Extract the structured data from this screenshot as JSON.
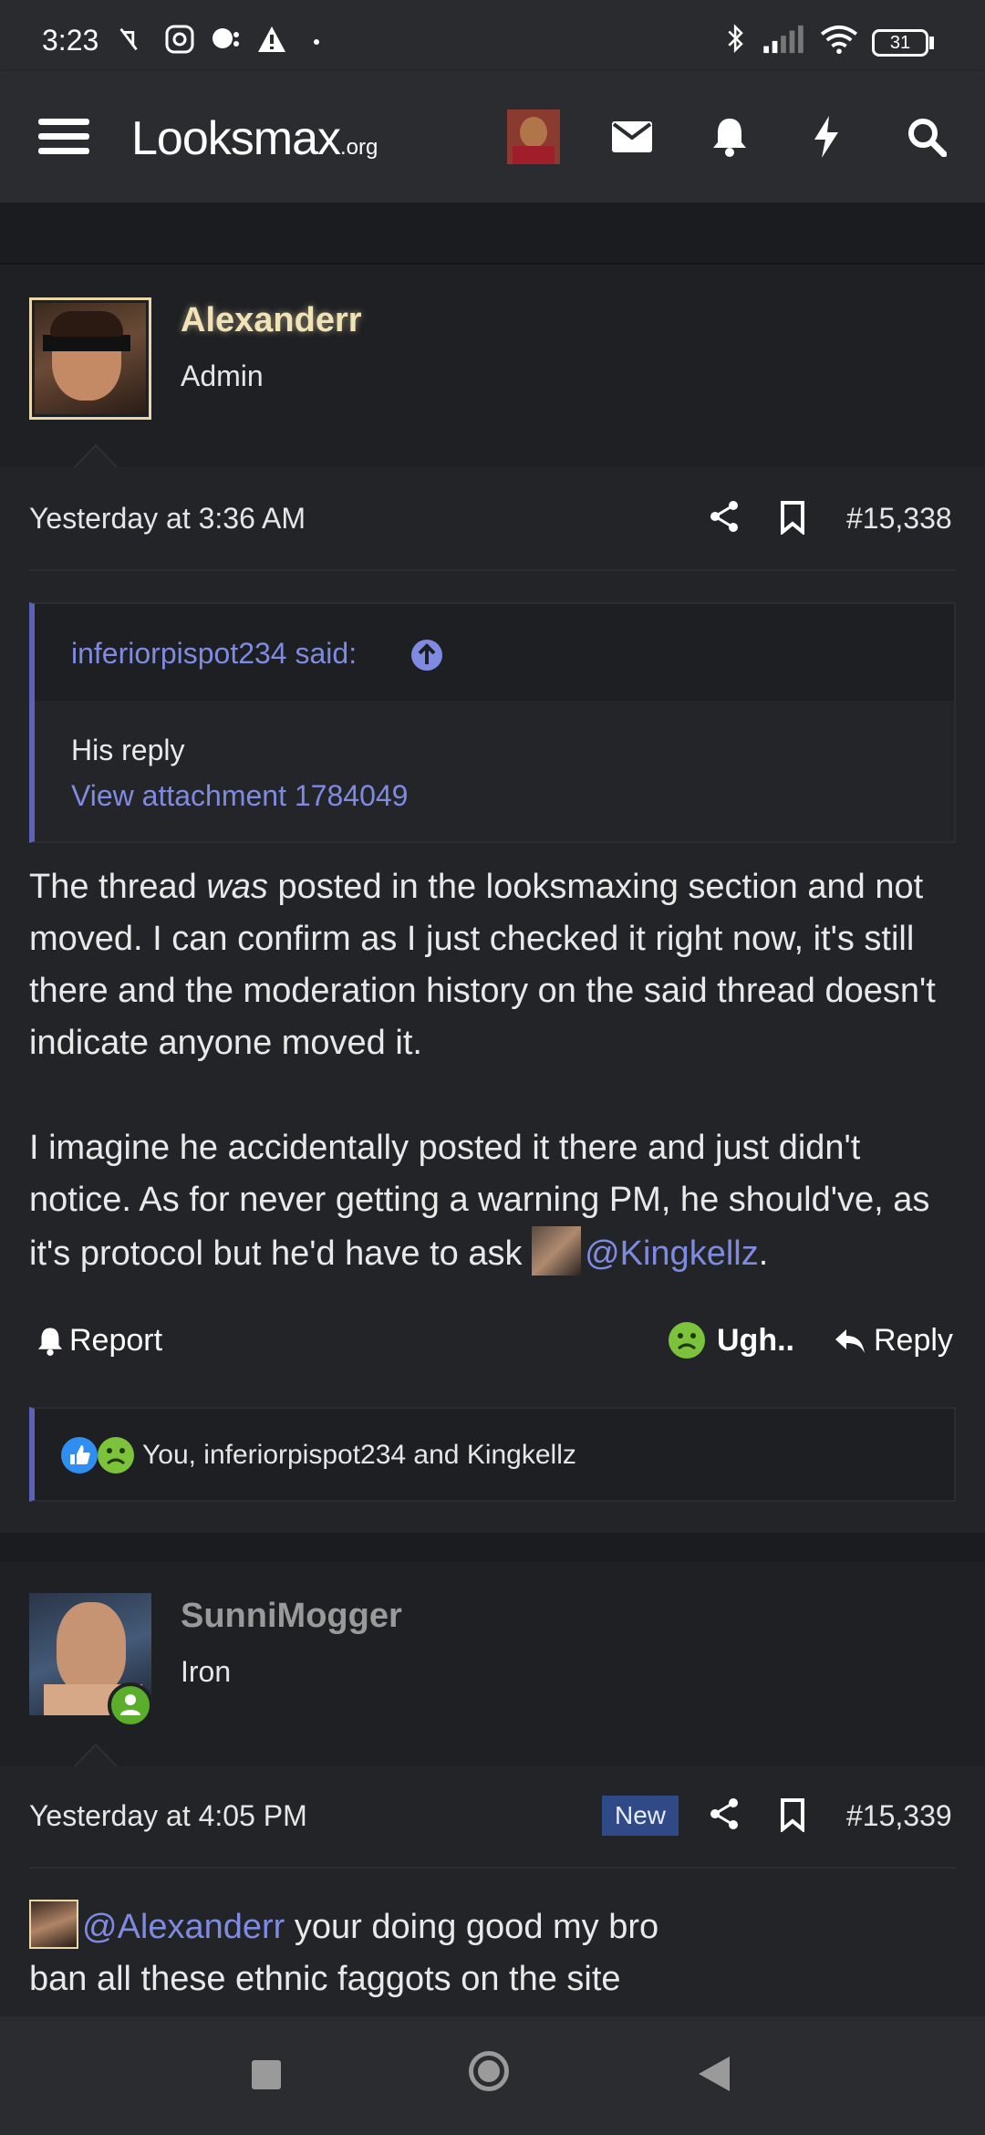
{
  "status_bar": {
    "time": "3:23",
    "battery": "31"
  },
  "nav": {
    "logo_main": "Looksmax",
    "logo_suffix": ".org"
  },
  "post1": {
    "username": "Alexanderr",
    "role": "Admin",
    "date": "Yesterday at 3:36 AM",
    "post_number": "#15,338",
    "quote": {
      "author": "inferiorpispot234 said:",
      "text": "His reply",
      "attachment_link": "View attachment 1784049"
    },
    "paragraph1_a": "The thread ",
    "paragraph1_em": "was",
    "paragraph1_b": " posted in the looksmaxing section and not moved. I can confirm as I just checked it right now, it's still there and the moderation history on the said thread doesn't indicate anyone moved it.",
    "paragraph2": "I imagine he accidentally posted it there and just didn't notice. As for never getting a warning PM, he should've, as it's protocol but he'd have to ask ",
    "mention": "@Kingkellz",
    "paragraph2_end": ".",
    "report_label": "Report",
    "reaction_label": "Ugh..",
    "reply_label": "Reply",
    "reactions_summary": "You, inferiorpispot234 and Kingkellz"
  },
  "post2": {
    "username": "SunniMogger",
    "role": "Iron",
    "date": "Yesterday at 4:05 PM",
    "new_badge": "New",
    "post_number": "#15,339",
    "mention": "@Alexanderr",
    "line1": " your doing good my bro",
    "line2": "ban all these ethnic faggots on the site"
  },
  "colors": {
    "accent_link": "#7f8be0",
    "admin_gold": "#f1e3b8",
    "quote_bar": "#5a63b8"
  }
}
